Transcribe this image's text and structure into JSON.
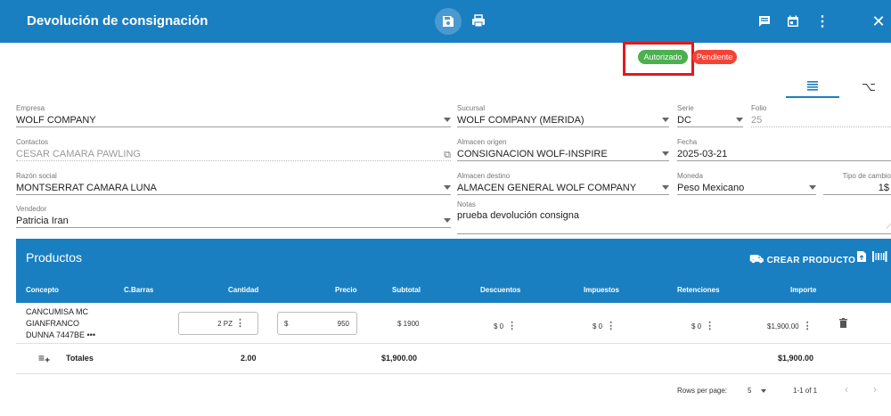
{
  "header": {
    "title": "Devolución de consignación",
    "icons": [
      "save-icon",
      "print-icon",
      "comment-icon",
      "calendar-icon",
      "more-vert-icon",
      "close-icon"
    ],
    "close_glyph": "✕",
    "more_glyph": "⋮"
  },
  "status": {
    "authorized": "Autorizado",
    "pending": "Pendiente",
    "colors": {
      "authorized": "#4caf50",
      "pending": "#f44336",
      "highlight": "#e0191e"
    }
  },
  "view_tabs": {
    "list_icon": "list-icon",
    "branch_icon": "branch-icon",
    "branch_glyph": "⌥"
  },
  "form": {
    "empresa": {
      "label": "Empresa",
      "value": "WOLF COMPANY"
    },
    "sucursal": {
      "label": "Sucursal",
      "value": "WOLF COMPANY (MERIDA)"
    },
    "serie": {
      "label": "Serie",
      "value": "DC"
    },
    "folio": {
      "label": "Folio",
      "value": "25"
    },
    "contactos": {
      "label": "Contactos",
      "value": "CESAR CAMARA PAWLING"
    },
    "almacen_origen": {
      "label": "Almacen origen",
      "value": "CONSIGNACION WOLF-INSPIRE"
    },
    "fecha": {
      "label": "Fecha",
      "value": "2025-03-21"
    },
    "razon_social": {
      "label": "Razón social",
      "value": "MONTSERRAT CAMARA LUNA"
    },
    "almacen_destino": {
      "label": "Almacen destino",
      "value": "ALMACEN GENERAL WOLF COMPANY"
    },
    "moneda": {
      "label": "Moneda",
      "value": "Peso Mexicano"
    },
    "tipo_cambio": {
      "label": "Tipo de cambio",
      "value": "1$"
    },
    "vendedor": {
      "label": "Vendedor",
      "value": "Patricia Iran"
    },
    "notas": {
      "label": "Notas",
      "value": "prueba devolución consigna"
    }
  },
  "products": {
    "title": "Productos",
    "create_label": "CREAR PRODUCTO",
    "columns": {
      "concepto": "Concepto",
      "barras": "C.Barras",
      "cantidad": "Cantidad",
      "precio": "Precio",
      "subtotal": "Subtotal",
      "descuentos": "Descuentos",
      "impuestos": "Impuestos",
      "retenciones": "Retenciones",
      "importe": "Importe"
    },
    "rows": [
      {
        "concept_line1": "CANCUMISA MC",
        "concept_line2": "GIANFRANCO",
        "concept_line3": "DUNNA 7447BE •••",
        "cantidad": "2 PZ",
        "precio_prefix": "$",
        "precio": "950",
        "subtotal": "$ 1900",
        "descuentos": "$ 0",
        "impuestos": "$ 0",
        "retenciones": "$ 0",
        "importe": "$1,900.00"
      }
    ],
    "totals": {
      "label": "Totales",
      "cantidad": "2.00",
      "subtotal": "$1,900.00",
      "importe": "$1,900.00"
    },
    "pagination": {
      "rows_per_page_label": "Rows per page:",
      "rows_per_page": "5",
      "range": "1-1 of 1"
    }
  }
}
